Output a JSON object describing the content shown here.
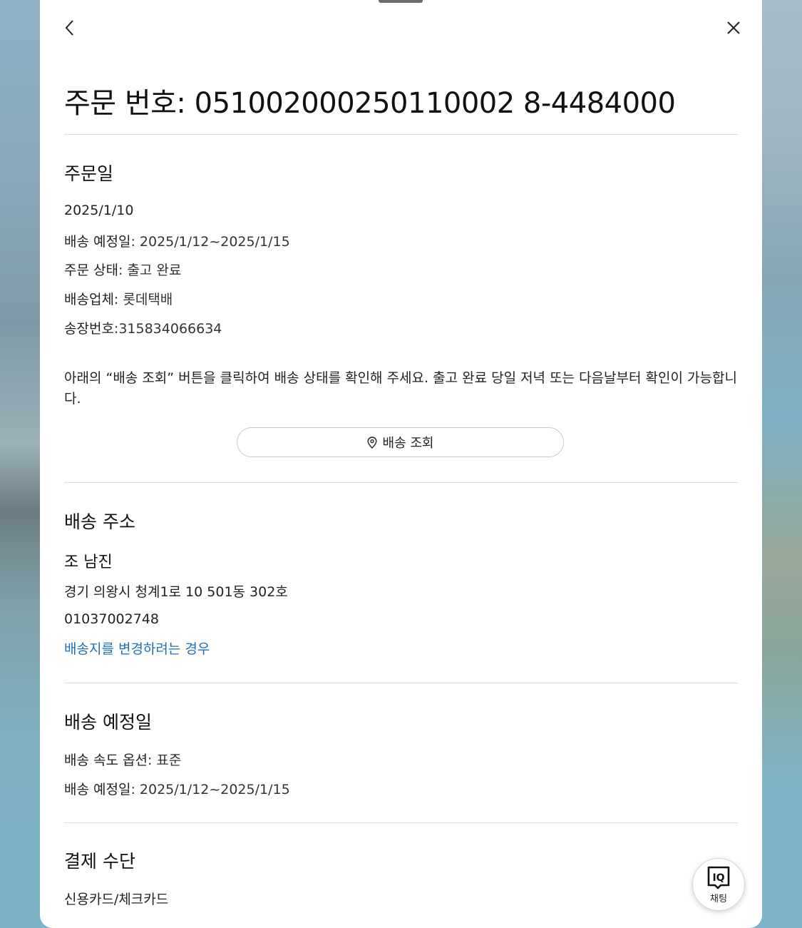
{
  "order": {
    "title_prefix": "주문 번호",
    "title_number": ": 051002000250110002 8-4484000"
  },
  "order_date_section": {
    "heading": "주문일",
    "date": "2025/1/10",
    "delivery_label": "배송 예정일",
    "delivery_value": ": 2025/1/12~2025/1/15",
    "status_label": "주문 상태",
    "status_value": ": 출고 완료",
    "carrier_label": "배송업체",
    "carrier_value": ": 롯데택배",
    "invoice_label": "송장번호",
    "invoice_value": ":315834066634",
    "notice": "아래의 “배송 조회” 버튼을 클릭하여 배송 상태를 확인해 주세요. 출고 완료 당일 저녁 또는 다음날부터 확인이 가능합니다.",
    "track_button": "배송 조회"
  },
  "address_section": {
    "heading": "배송 주소",
    "name": "조 남진",
    "address": "경기 의왕시 청계1로 10 501동 302호",
    "phone": "01037002748",
    "change_link": "배송지를 변경하려는 경우"
  },
  "schedule_section": {
    "heading": "배송 예정일",
    "speed_label": "배송 속도 옵션",
    "speed_value": ": 표준",
    "delivery_label": "배송 예정일",
    "delivery_value": ": 2025/1/12~2025/1/15"
  },
  "payment_section": {
    "heading": "결제 수단",
    "method": "신용카드/체크카드"
  },
  "chat": {
    "logo_text": "IQ",
    "label": "채팅"
  },
  "colors": {
    "link": "#1f6fb5",
    "divider": "#dcdcdc"
  }
}
